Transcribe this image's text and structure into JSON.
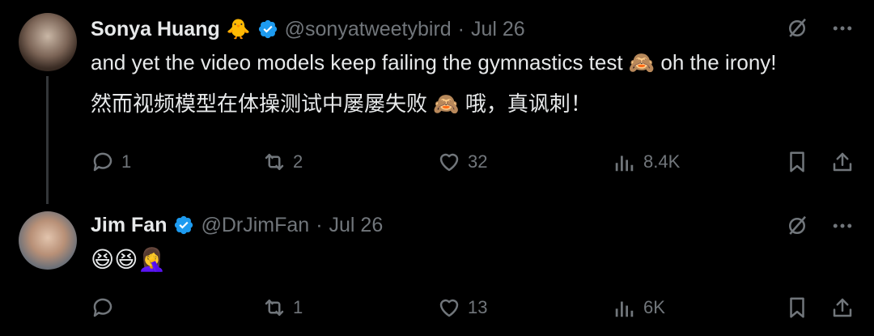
{
  "tweets": [
    {
      "author_name": "Sonya Huang",
      "author_emoji": "🐥",
      "handle": "@sonyatweetybird",
      "separator": "·",
      "date": "Jul 26",
      "text_line1": "and yet the video models keep failing the gymnastics test 🙈 oh the irony!",
      "text_line2": "然而视频模型在体操测试中屡屡失败 🙈 哦，真讽刺！",
      "stats": {
        "replies": "1",
        "retweets": "2",
        "likes": "32",
        "views": "8.4K"
      }
    },
    {
      "author_name": "Jim Fan",
      "handle": "@DrJimFan",
      "separator": "·",
      "date": "Jul 26",
      "text_line1": "😆😆🤦‍♀️",
      "stats": {
        "replies": "",
        "retweets": "1",
        "likes": "13",
        "views": "6K"
      }
    }
  ],
  "colors": {
    "background": "#000000",
    "text": "#e7e9ea",
    "muted": "#71767b",
    "verified": "#1d9bf0",
    "thread_line": "#333639"
  },
  "icons": [
    "grok-icon",
    "more-icon",
    "reply-icon",
    "retweet-icon",
    "like-icon",
    "views-icon",
    "bookmark-icon",
    "share-icon",
    "verified-badge-icon"
  ]
}
